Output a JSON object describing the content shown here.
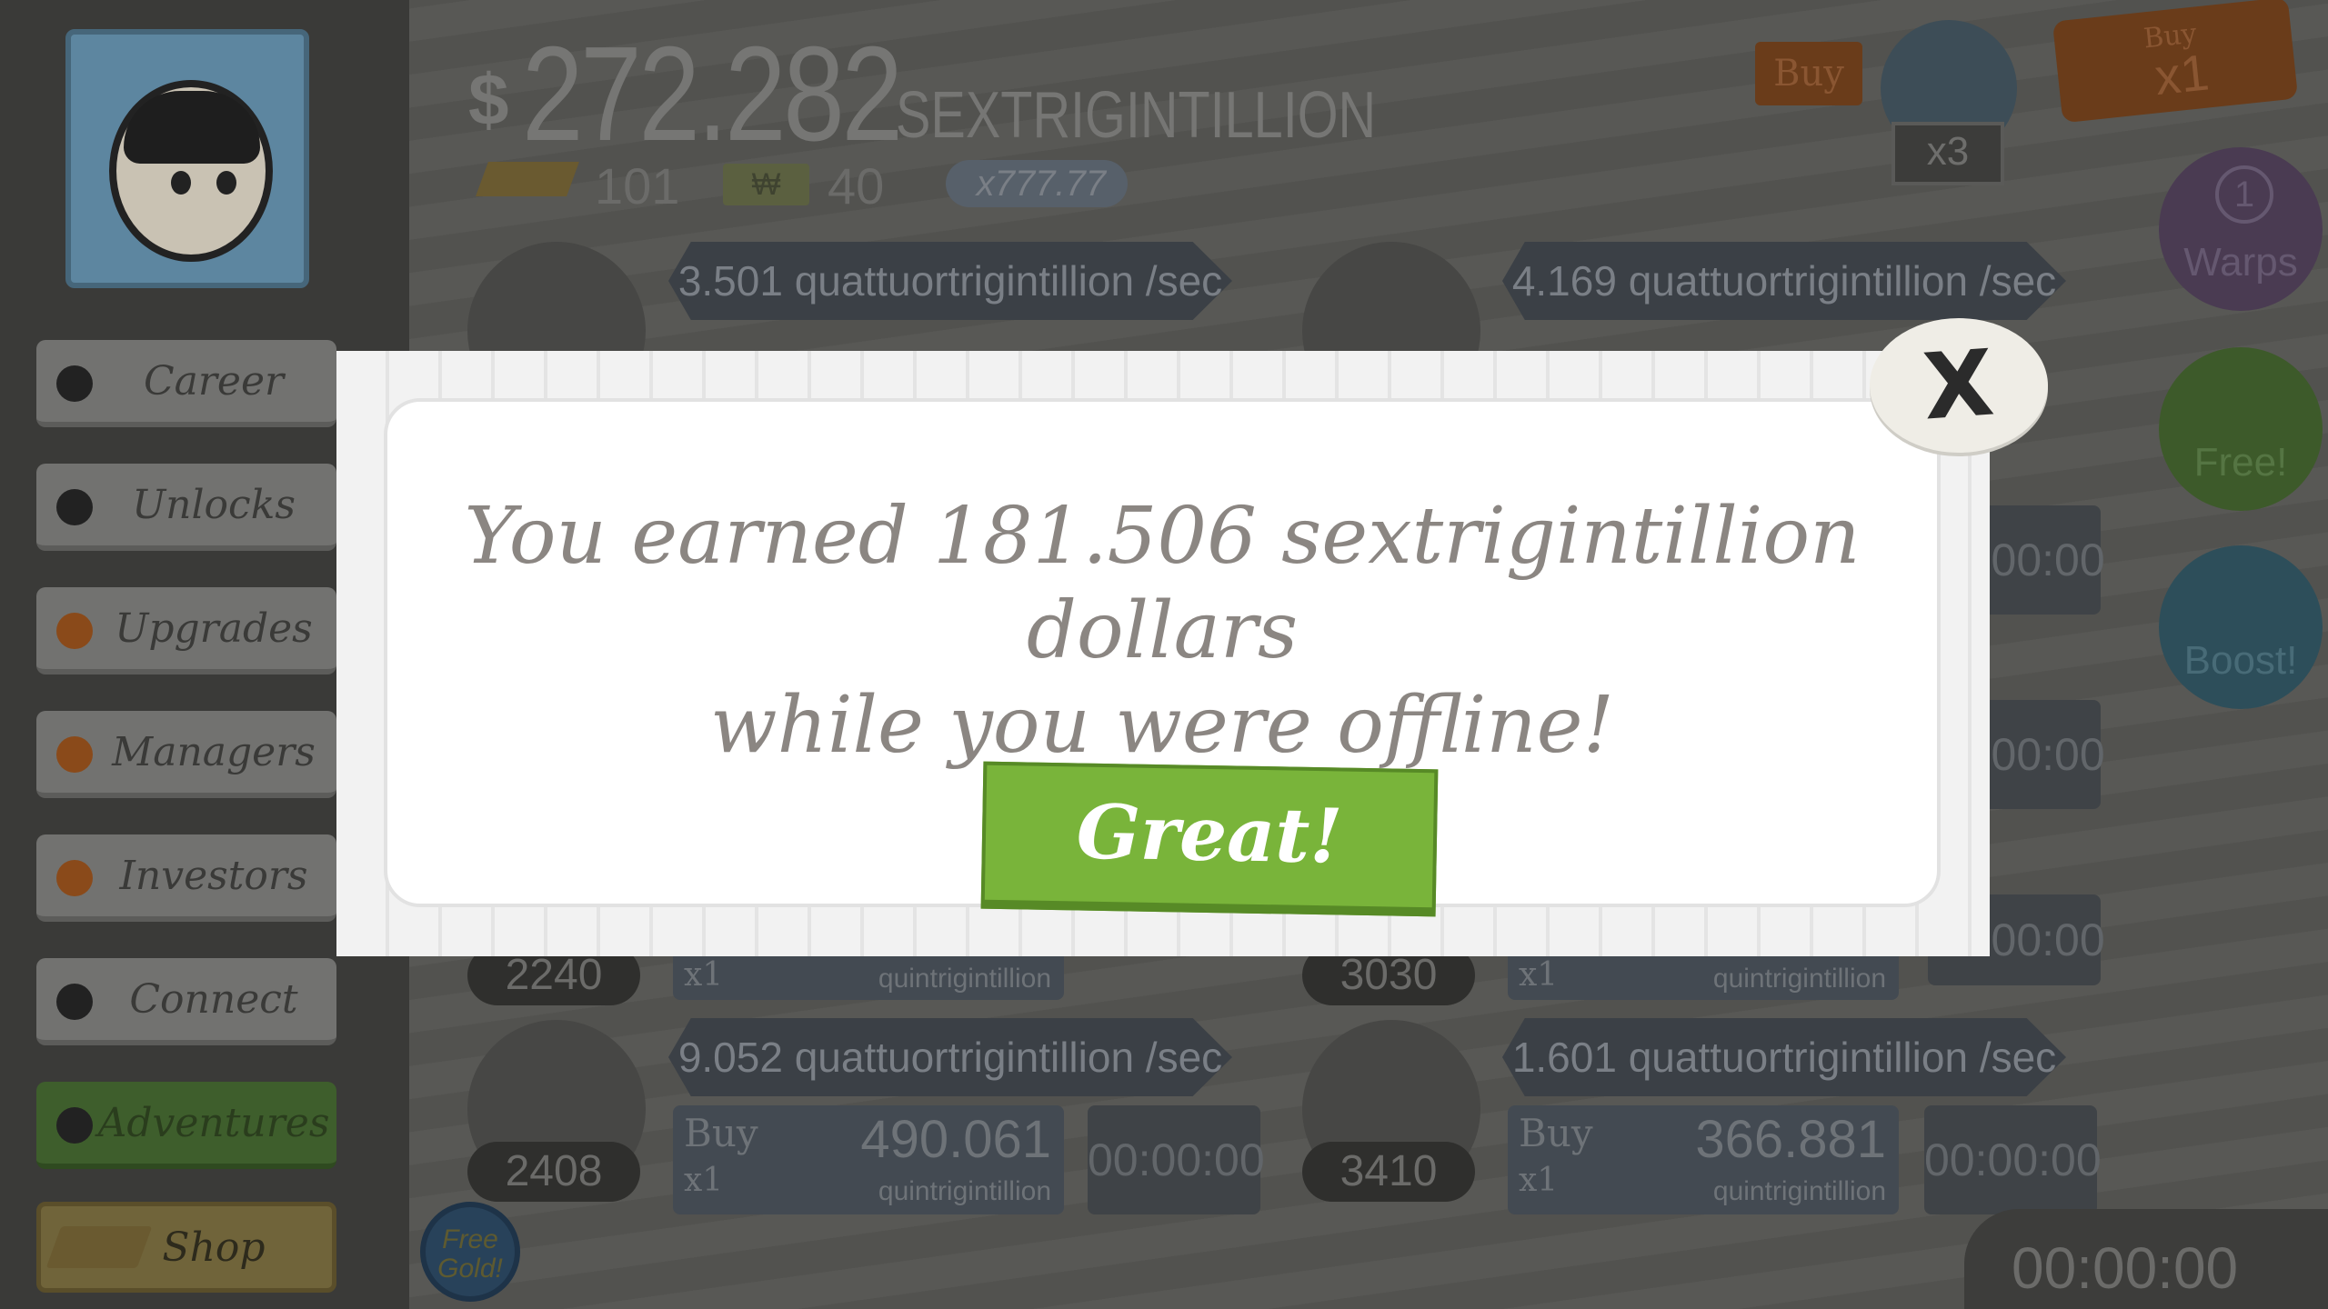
{
  "header": {
    "currency_symbol": "$",
    "money_amount": "272.282",
    "money_unit": "SEXTRIGINTILLION",
    "gold_count": "101",
    "megabucks_count": "40",
    "megabucks_symbol": "₩",
    "angel_multiplier": "x777.77",
    "buy_label": "Buy",
    "video_multiplier": "x3",
    "buy_quantity_label": "Buy",
    "buy_quantity_value": "x1"
  },
  "sidebar": {
    "items": [
      {
        "label": "Career"
      },
      {
        "label": "Unlocks"
      },
      {
        "label": "Upgrades"
      },
      {
        "label": "Managers"
      },
      {
        "label": "Investors"
      },
      {
        "label": "Connect"
      },
      {
        "label": "Adventures"
      },
      {
        "label": "Shop"
      }
    ]
  },
  "right_badges": {
    "warps_count": "1",
    "warps_label": "Warps",
    "free_label": "Free!",
    "boost_label": "Boost!"
  },
  "businesses": [
    {
      "rate": "3.501 quattuortrigintillion /sec"
    },
    {
      "rate": "4.169 quattuortrigintillion /sec"
    },
    {
      "count": "2240",
      "buy": "Buy",
      "qty": "x1",
      "unit": "quintrigintillion"
    },
    {
      "count": "3030",
      "buy": "Buy",
      "qty": "x1",
      "unit": "quintrigintillion"
    },
    {
      "rate": "9.052 quattuortrigintillion /sec",
      "count": "2408",
      "buy": "Buy",
      "qty": "x1",
      "cost": "490.061",
      "unit": "quintrigintillion",
      "timer": "00:00:00"
    },
    {
      "rate": "1.601 quattuortrigintillion /sec",
      "count": "3410",
      "buy": "Buy",
      "qty": "x1",
      "cost": "366.881",
      "unit": "quintrigintillion",
      "timer": "00:00:00"
    }
  ],
  "partial_timers": [
    "00:00:00",
    "00:00:00",
    "00:00:00",
    "00:00:00"
  ],
  "bottom": {
    "free_gold": "Free Gold!",
    "timer": "00:00:00"
  },
  "modal": {
    "message_line1": "You earned 181.506 sextrigintillion dollars",
    "message_line2": "while you were offline!",
    "confirm_label": "Great!",
    "close_label": "X"
  }
}
